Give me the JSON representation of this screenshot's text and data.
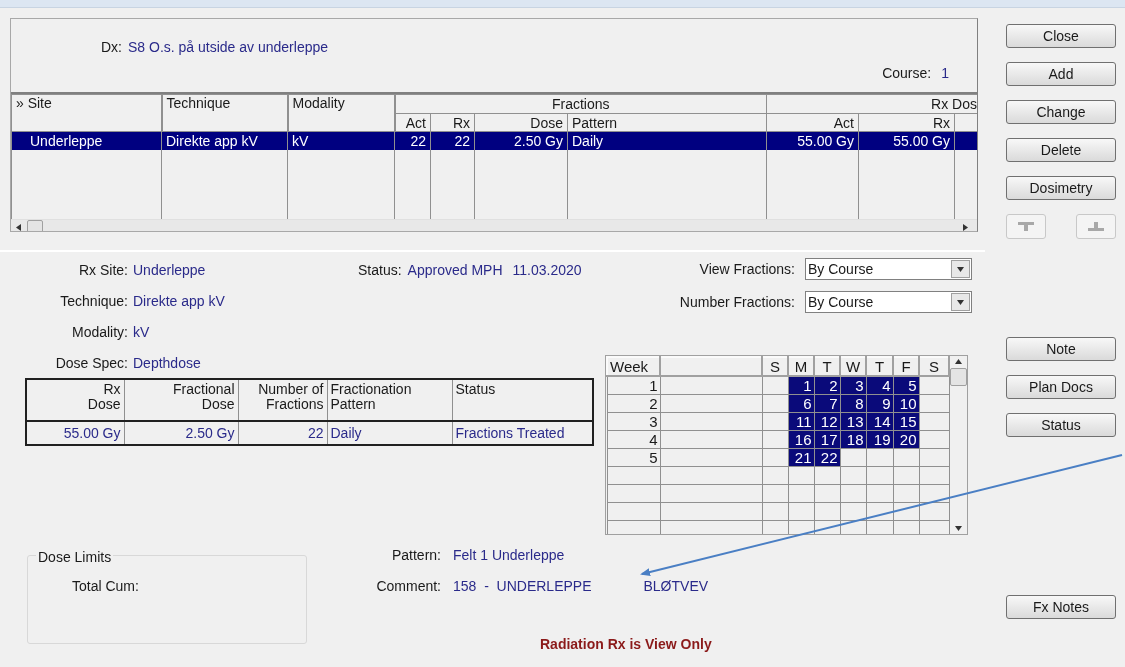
{
  "dx": {
    "label": "Dx:",
    "value": "S8 O.s. på utside av underleppe"
  },
  "course": {
    "label": "Course:",
    "value": "1"
  },
  "site_grid": {
    "column_groups": [
      "Fractions",
      "Rx Dos"
    ],
    "columns": [
      "» Site",
      "Technique",
      "Modality",
      "Act",
      "Rx",
      "Dose",
      "Pattern",
      "Act",
      "Rx"
    ],
    "rows": [
      {
        "selected": true,
        "cells": [
          "Underleppe",
          "Direkte app kV",
          "kV",
          "22",
          "22",
          "2.50 Gy",
          "Daily",
          "55.00 Gy",
          "55.00 Gy"
        ]
      }
    ]
  },
  "buttons": [
    {
      "label": "Close"
    },
    {
      "label": "Add"
    },
    {
      "label": "Change"
    },
    {
      "label": "Delete"
    },
    {
      "label": "Dosimetry"
    }
  ],
  "tool_buttons": [
    {
      "kind": "down",
      "disabled": true
    },
    {
      "kind": "up",
      "disabled": true
    }
  ],
  "details": [
    {
      "label": "Rx Site:",
      "value": "Underleppe"
    },
    {
      "label": "Technique:",
      "value": "Direkte app kV"
    },
    {
      "label": "Modality:",
      "value": "kV"
    },
    {
      "label": "Dose Spec:",
      "value": "Depthdose"
    }
  ],
  "status": {
    "label": "Status:",
    "value": "Approved MPH",
    "date": "11.03.2020"
  },
  "selects": [
    {
      "label": "View Fractions:",
      "value": "By Course"
    },
    {
      "label": "Number Fractions:",
      "value": "By Course"
    }
  ],
  "rx_table": {
    "columns": [
      "Rx\nDose",
      "Fractional\nDose",
      "Number of\nFractions",
      "Fractionation\nPattern",
      "Status"
    ],
    "rows": [
      [
        "55.00 Gy",
        "2.50 Gy",
        "22",
        "Daily",
        "Fractions Treated"
      ]
    ]
  },
  "calendar": {
    "columns": [
      "Week",
      "S",
      "M",
      "T",
      "W",
      "T",
      "F",
      "S"
    ],
    "rows": [
      {
        "week": "1",
        "fractions": [
          "1",
          "2",
          "3",
          "4",
          "5"
        ]
      },
      {
        "week": "2",
        "fractions": [
          "6",
          "7",
          "8",
          "9",
          "10"
        ]
      },
      {
        "week": "3",
        "fractions": [
          "11",
          "12",
          "13",
          "14",
          "15"
        ]
      },
      {
        "week": "4",
        "fractions": [
          "16",
          "17",
          "18",
          "19",
          "20"
        ]
      },
      {
        "week": "5",
        "fractions": [
          "21",
          "22"
        ]
      }
    ]
  },
  "side_buttons": [
    {
      "label": "Note"
    },
    {
      "label": "Plan Docs"
    },
    {
      "label": "Status"
    }
  ],
  "dose_limits": {
    "title": "Dose Limits",
    "fields": [
      "Total Cum:"
    ]
  },
  "notes": [
    {
      "label": "Pattern:",
      "values": [
        "Felt 1 Underleppe"
      ]
    },
    {
      "label": "Comment:",
      "values": [
        "158  -  UNDERLEPPE",
        "BLØTVEV"
      ]
    }
  ],
  "fx_notes_button": {
    "label": "Fx Notes"
  },
  "footer": "Radiation Rx is View Only"
}
